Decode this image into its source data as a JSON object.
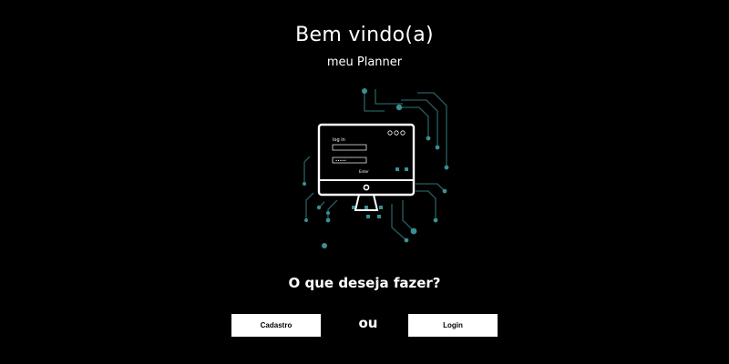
{
  "header": {
    "title": "Bem vindo(a)",
    "subtitle": "meu Planner"
  },
  "illustration": {
    "screen_heading": "log in",
    "password_mask": "•••••",
    "enter_label": "Enter",
    "icon": "computer-login-icon",
    "accent_color": "#3a8f93"
  },
  "main": {
    "question": "O que deseja fazer?",
    "cadastro_label": "Cadastro",
    "separator": "ou",
    "login_label": "Login"
  },
  "colors": {
    "background": "#000000",
    "text": "#ffffff",
    "button_bg": "#ffffff",
    "button_text": "#000000"
  }
}
